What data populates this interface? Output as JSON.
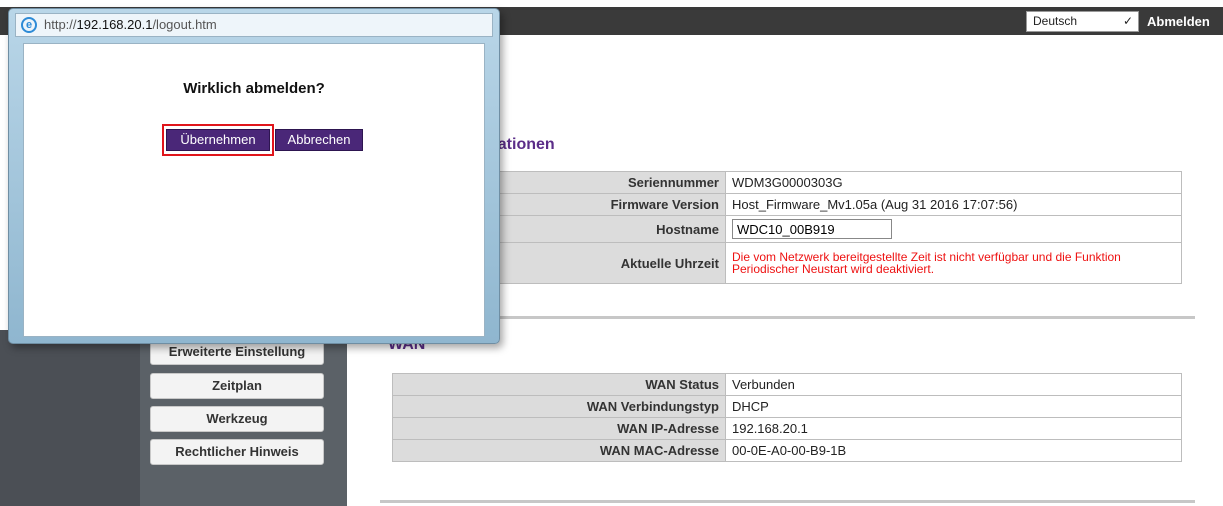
{
  "header": {
    "language": "Deutsch",
    "logout_label": "Abmelden"
  },
  "popup": {
    "url_prefix": "http://",
    "url_host": "192.168.20.1",
    "url_path": "/logout.htm",
    "question": "Wirklich abmelden?",
    "confirm_label": "Übernehmen",
    "cancel_label": "Abbrechen"
  },
  "sidebar": {
    "items": [
      {
        "label": "Erweiterte Einstellung"
      },
      {
        "label": "Zeitplan"
      },
      {
        "label": "Werkzeug"
      },
      {
        "label": "Rechtlicher Hinweis"
      }
    ]
  },
  "info": {
    "title_visible": "nationen",
    "rows": [
      {
        "label": "Seriennummer",
        "value": "WDM3G0000303G"
      },
      {
        "label": "Firmware Version",
        "value": "Host_Firmware_Mv1.05a (Aug 31 2016 17:07:56)"
      },
      {
        "label": "Hostname",
        "value": "WDC10_00B919"
      },
      {
        "label": "Aktuelle Uhrzeit",
        "value": "Die vom Netzwerk bereitgestellte Zeit ist nicht verfügbar und die Funktion Periodischer Neustart wird deaktiviert."
      }
    ]
  },
  "wan": {
    "title": "WAN",
    "rows": [
      {
        "label": "WAN Status",
        "value": "Verbunden"
      },
      {
        "label": "WAN Verbindungstyp",
        "value": "DHCP"
      },
      {
        "label": "WAN IP-Adresse",
        "value": "192.168.20.1"
      },
      {
        "label": "WAN MAC-Adresse",
        "value": "00-0E-A0-00-B9-1B"
      }
    ]
  },
  "colors": {
    "accent": "#4a2778",
    "title": "#5b2d88",
    "warning": "#e11111",
    "highlight": "#e0151b"
  }
}
